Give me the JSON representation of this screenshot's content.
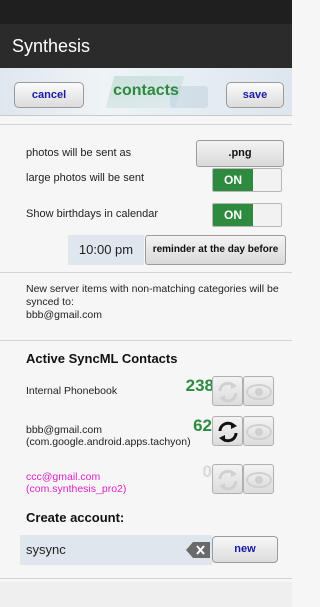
{
  "app_title": "Synthesis",
  "header": {
    "cancel_label": "cancel",
    "title": "contacts",
    "save_label": "save"
  },
  "settings": {
    "photo_format_label": "photos will be sent as",
    "photo_format_value": ".png",
    "large_photos_label": "large photos will be sent",
    "large_photos_value": "ON",
    "birthdays_label": "Show birthdays in calendar",
    "birthdays_value": "ON",
    "reminder_time": "10:00 pm",
    "reminder_label": "reminder at the day before"
  },
  "info_text": "New server items with non-matching categories will be synced to:\nbbb@gmail.com",
  "active_section_title": "Active SyncML Contacts",
  "accounts": [
    {
      "name": "Internal Phonebook",
      "count": "238",
      "enabled": true,
      "sync_active": false
    },
    {
      "name": "bbb@gmail.com\n(com.google.android.apps.tachyon)",
      "count": "62",
      "enabled": true,
      "sync_active": true
    },
    {
      "name": "ccc@gmail.com\n(com.synthesis_pro2)",
      "count": "0",
      "enabled": false,
      "sync_active": false
    }
  ],
  "create_account": {
    "title": "Create account:",
    "input_value": "sysync",
    "new_label": "new"
  },
  "colors": {
    "accent_green": "#2e8a3e",
    "button_text_blue": "#1a1aa8",
    "disabled_magenta": "#e020c8"
  }
}
